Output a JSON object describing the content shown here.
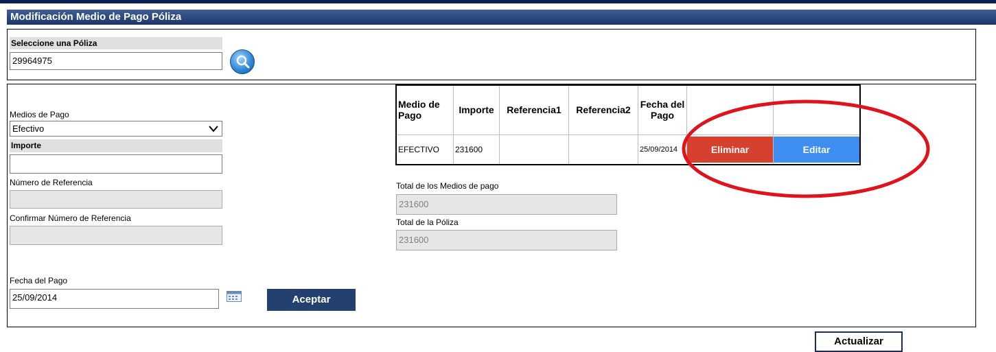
{
  "window": {
    "title": "Modificación Medio de Pago Póliza"
  },
  "poliza": {
    "label": "Seleccione una Póliza",
    "value": "29964975"
  },
  "form": {
    "medios_label": "Medios de Pago",
    "medio_selected": "Efectivo",
    "importe_label": "Importe",
    "importe_value": "",
    "ref_label": "Número de Referencia",
    "ref_value": "",
    "confirm_label": "Confirmar Número de Referencia",
    "confirm_value": "",
    "fecha_label": "Fecha del Pago",
    "fecha_value": "25/09/2014",
    "aceptar": "Aceptar"
  },
  "table": {
    "headers": {
      "medio": "Medio de Pago",
      "importe": "Importe",
      "ref1": "Referencia1",
      "ref2": "Referencia2",
      "fecha": "Fecha del Pago"
    },
    "rows": [
      {
        "medio": "EFECTIVO",
        "importe": "231600",
        "ref1": "",
        "ref2": "",
        "fecha": "25/09/2014",
        "eliminar": "Eliminar",
        "editar": "Editar"
      }
    ]
  },
  "totals": {
    "medios_label": "Total de los Medios de pago",
    "medios_value": "231600",
    "poliza_label": "Total de la Póliza",
    "poliza_value": "231600"
  },
  "footer": {
    "actualizar": "Actualizar"
  },
  "colors": {
    "title_bg": "#1d3568",
    "eliminar": "#d6402f",
    "editar": "#3d8ef0",
    "annotation": "#e0121b"
  }
}
